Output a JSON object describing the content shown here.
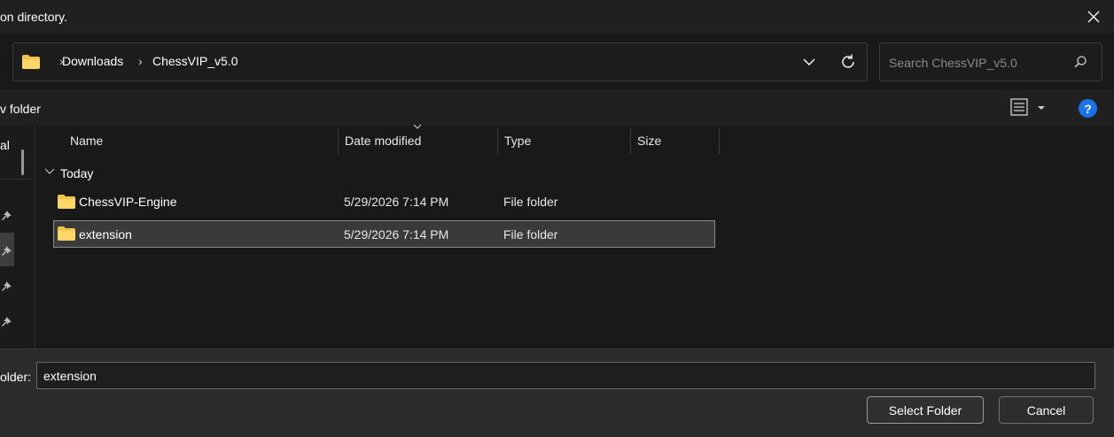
{
  "window": {
    "title": "on directory.",
    "close_icon": "close-icon"
  },
  "address": {
    "folder_icon": "folder-icon",
    "crumbs": [
      "Downloads",
      "ChessVIP_v5.0"
    ],
    "dropdown_icon": "chevron-down-icon",
    "refresh_icon": "refresh-icon"
  },
  "search": {
    "placeholder": "Search ChessVIP_v5.0",
    "icon": "search-icon"
  },
  "commandbar": {
    "new_folder_label": "v folder",
    "view_icon": "view-details-icon",
    "help_label": "?"
  },
  "navpane": {
    "partial_label": "al",
    "pin_icon": "pin-icon"
  },
  "columns": {
    "name": "Name",
    "date": "Date modified",
    "type": "Type",
    "size": "Size"
  },
  "group": {
    "label": "Today"
  },
  "files": [
    {
      "name": "ChessVIP-Engine",
      "date": "5/29/2026 7:14 PM",
      "type": "File folder",
      "selected": false
    },
    {
      "name": "extension",
      "date": "5/29/2026 7:14 PM",
      "type": "File folder",
      "selected": true
    }
  ],
  "footer": {
    "folder_label": "older:",
    "folder_value": "extension",
    "select_label": "Select Folder",
    "cancel_label": "Cancel"
  },
  "colors": {
    "folder": "#f4c34a",
    "accent": "#1a73e8"
  }
}
